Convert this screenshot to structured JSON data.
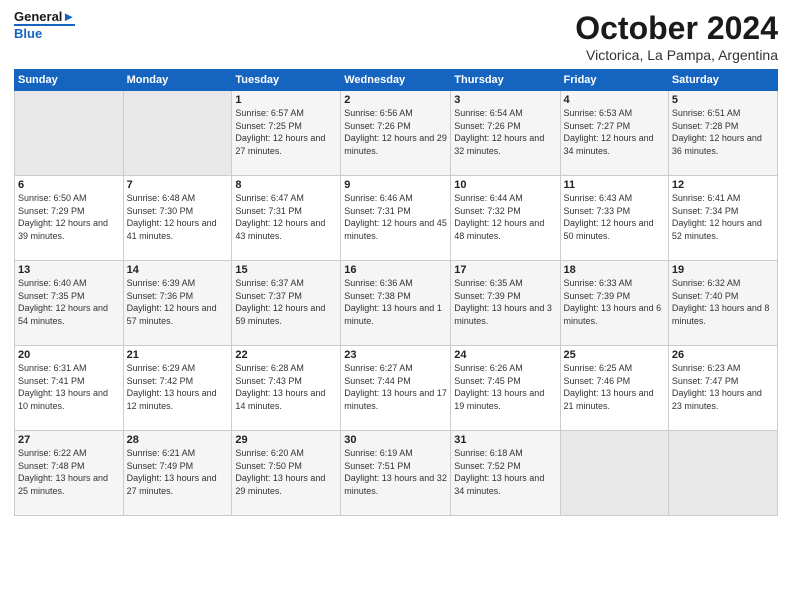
{
  "header": {
    "logo_line1": "General",
    "logo_line2": "Blue",
    "title": "October 2024",
    "subtitle": "Victorica, La Pampa, Argentina"
  },
  "days_of_week": [
    "Sunday",
    "Monday",
    "Tuesday",
    "Wednesday",
    "Thursday",
    "Friday",
    "Saturday"
  ],
  "weeks": [
    [
      {
        "day": "",
        "sunrise": "",
        "sunset": "",
        "daylight": ""
      },
      {
        "day": "",
        "sunrise": "",
        "sunset": "",
        "daylight": ""
      },
      {
        "day": "1",
        "sunrise": "Sunrise: 6:57 AM",
        "sunset": "Sunset: 7:25 PM",
        "daylight": "Daylight: 12 hours and 27 minutes."
      },
      {
        "day": "2",
        "sunrise": "Sunrise: 6:56 AM",
        "sunset": "Sunset: 7:26 PM",
        "daylight": "Daylight: 12 hours and 29 minutes."
      },
      {
        "day": "3",
        "sunrise": "Sunrise: 6:54 AM",
        "sunset": "Sunset: 7:26 PM",
        "daylight": "Daylight: 12 hours and 32 minutes."
      },
      {
        "day": "4",
        "sunrise": "Sunrise: 6:53 AM",
        "sunset": "Sunset: 7:27 PM",
        "daylight": "Daylight: 12 hours and 34 minutes."
      },
      {
        "day": "5",
        "sunrise": "Sunrise: 6:51 AM",
        "sunset": "Sunset: 7:28 PM",
        "daylight": "Daylight: 12 hours and 36 minutes."
      }
    ],
    [
      {
        "day": "6",
        "sunrise": "Sunrise: 6:50 AM",
        "sunset": "Sunset: 7:29 PM",
        "daylight": "Daylight: 12 hours and 39 minutes."
      },
      {
        "day": "7",
        "sunrise": "Sunrise: 6:48 AM",
        "sunset": "Sunset: 7:30 PM",
        "daylight": "Daylight: 12 hours and 41 minutes."
      },
      {
        "day": "8",
        "sunrise": "Sunrise: 6:47 AM",
        "sunset": "Sunset: 7:31 PM",
        "daylight": "Daylight: 12 hours and 43 minutes."
      },
      {
        "day": "9",
        "sunrise": "Sunrise: 6:46 AM",
        "sunset": "Sunset: 7:31 PM",
        "daylight": "Daylight: 12 hours and 45 minutes."
      },
      {
        "day": "10",
        "sunrise": "Sunrise: 6:44 AM",
        "sunset": "Sunset: 7:32 PM",
        "daylight": "Daylight: 12 hours and 48 minutes."
      },
      {
        "day": "11",
        "sunrise": "Sunrise: 6:43 AM",
        "sunset": "Sunset: 7:33 PM",
        "daylight": "Daylight: 12 hours and 50 minutes."
      },
      {
        "day": "12",
        "sunrise": "Sunrise: 6:41 AM",
        "sunset": "Sunset: 7:34 PM",
        "daylight": "Daylight: 12 hours and 52 minutes."
      }
    ],
    [
      {
        "day": "13",
        "sunrise": "Sunrise: 6:40 AM",
        "sunset": "Sunset: 7:35 PM",
        "daylight": "Daylight: 12 hours and 54 minutes."
      },
      {
        "day": "14",
        "sunrise": "Sunrise: 6:39 AM",
        "sunset": "Sunset: 7:36 PM",
        "daylight": "Daylight: 12 hours and 57 minutes."
      },
      {
        "day": "15",
        "sunrise": "Sunrise: 6:37 AM",
        "sunset": "Sunset: 7:37 PM",
        "daylight": "Daylight: 12 hours and 59 minutes."
      },
      {
        "day": "16",
        "sunrise": "Sunrise: 6:36 AM",
        "sunset": "Sunset: 7:38 PM",
        "daylight": "Daylight: 13 hours and 1 minute."
      },
      {
        "day": "17",
        "sunrise": "Sunrise: 6:35 AM",
        "sunset": "Sunset: 7:39 PM",
        "daylight": "Daylight: 13 hours and 3 minutes."
      },
      {
        "day": "18",
        "sunrise": "Sunrise: 6:33 AM",
        "sunset": "Sunset: 7:39 PM",
        "daylight": "Daylight: 13 hours and 6 minutes."
      },
      {
        "day": "19",
        "sunrise": "Sunrise: 6:32 AM",
        "sunset": "Sunset: 7:40 PM",
        "daylight": "Daylight: 13 hours and 8 minutes."
      }
    ],
    [
      {
        "day": "20",
        "sunrise": "Sunrise: 6:31 AM",
        "sunset": "Sunset: 7:41 PM",
        "daylight": "Daylight: 13 hours and 10 minutes."
      },
      {
        "day": "21",
        "sunrise": "Sunrise: 6:29 AM",
        "sunset": "Sunset: 7:42 PM",
        "daylight": "Daylight: 13 hours and 12 minutes."
      },
      {
        "day": "22",
        "sunrise": "Sunrise: 6:28 AM",
        "sunset": "Sunset: 7:43 PM",
        "daylight": "Daylight: 13 hours and 14 minutes."
      },
      {
        "day": "23",
        "sunrise": "Sunrise: 6:27 AM",
        "sunset": "Sunset: 7:44 PM",
        "daylight": "Daylight: 13 hours and 17 minutes."
      },
      {
        "day": "24",
        "sunrise": "Sunrise: 6:26 AM",
        "sunset": "Sunset: 7:45 PM",
        "daylight": "Daylight: 13 hours and 19 minutes."
      },
      {
        "day": "25",
        "sunrise": "Sunrise: 6:25 AM",
        "sunset": "Sunset: 7:46 PM",
        "daylight": "Daylight: 13 hours and 21 minutes."
      },
      {
        "day": "26",
        "sunrise": "Sunrise: 6:23 AM",
        "sunset": "Sunset: 7:47 PM",
        "daylight": "Daylight: 13 hours and 23 minutes."
      }
    ],
    [
      {
        "day": "27",
        "sunrise": "Sunrise: 6:22 AM",
        "sunset": "Sunset: 7:48 PM",
        "daylight": "Daylight: 13 hours and 25 minutes."
      },
      {
        "day": "28",
        "sunrise": "Sunrise: 6:21 AM",
        "sunset": "Sunset: 7:49 PM",
        "daylight": "Daylight: 13 hours and 27 minutes."
      },
      {
        "day": "29",
        "sunrise": "Sunrise: 6:20 AM",
        "sunset": "Sunset: 7:50 PM",
        "daylight": "Daylight: 13 hours and 29 minutes."
      },
      {
        "day": "30",
        "sunrise": "Sunrise: 6:19 AM",
        "sunset": "Sunset: 7:51 PM",
        "daylight": "Daylight: 13 hours and 32 minutes."
      },
      {
        "day": "31",
        "sunrise": "Sunrise: 6:18 AM",
        "sunset": "Sunset: 7:52 PM",
        "daylight": "Daylight: 13 hours and 34 minutes."
      },
      {
        "day": "",
        "sunrise": "",
        "sunset": "",
        "daylight": ""
      },
      {
        "day": "",
        "sunrise": "",
        "sunset": "",
        "daylight": ""
      }
    ]
  ]
}
